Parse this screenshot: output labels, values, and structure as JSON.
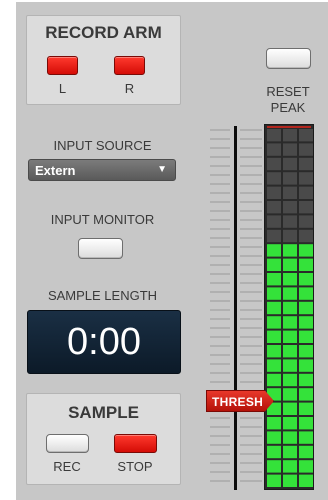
{
  "record_arm": {
    "title": "RECORD ARM",
    "left_label": "L",
    "right_label": "R"
  },
  "reset_peak": {
    "line1": "RESET",
    "line2": "PEAK"
  },
  "input_source": {
    "label": "INPUT SOURCE",
    "value": "Extern"
  },
  "input_monitor": {
    "label": "INPUT MONITOR"
  },
  "sample_length": {
    "label": "SAMPLE LENGTH",
    "value": "0:00"
  },
  "sample": {
    "title": "SAMPLE",
    "rec_label": "REC",
    "stop_label": "STOP"
  },
  "threshold": {
    "label": "THRESH"
  },
  "meter": {
    "segments": 25,
    "lit_segments": 17,
    "channels": 3
  },
  "colors": {
    "armed_red": "#e5140d",
    "meter_green": "#34e23a",
    "display_bg": "#13263a"
  }
}
